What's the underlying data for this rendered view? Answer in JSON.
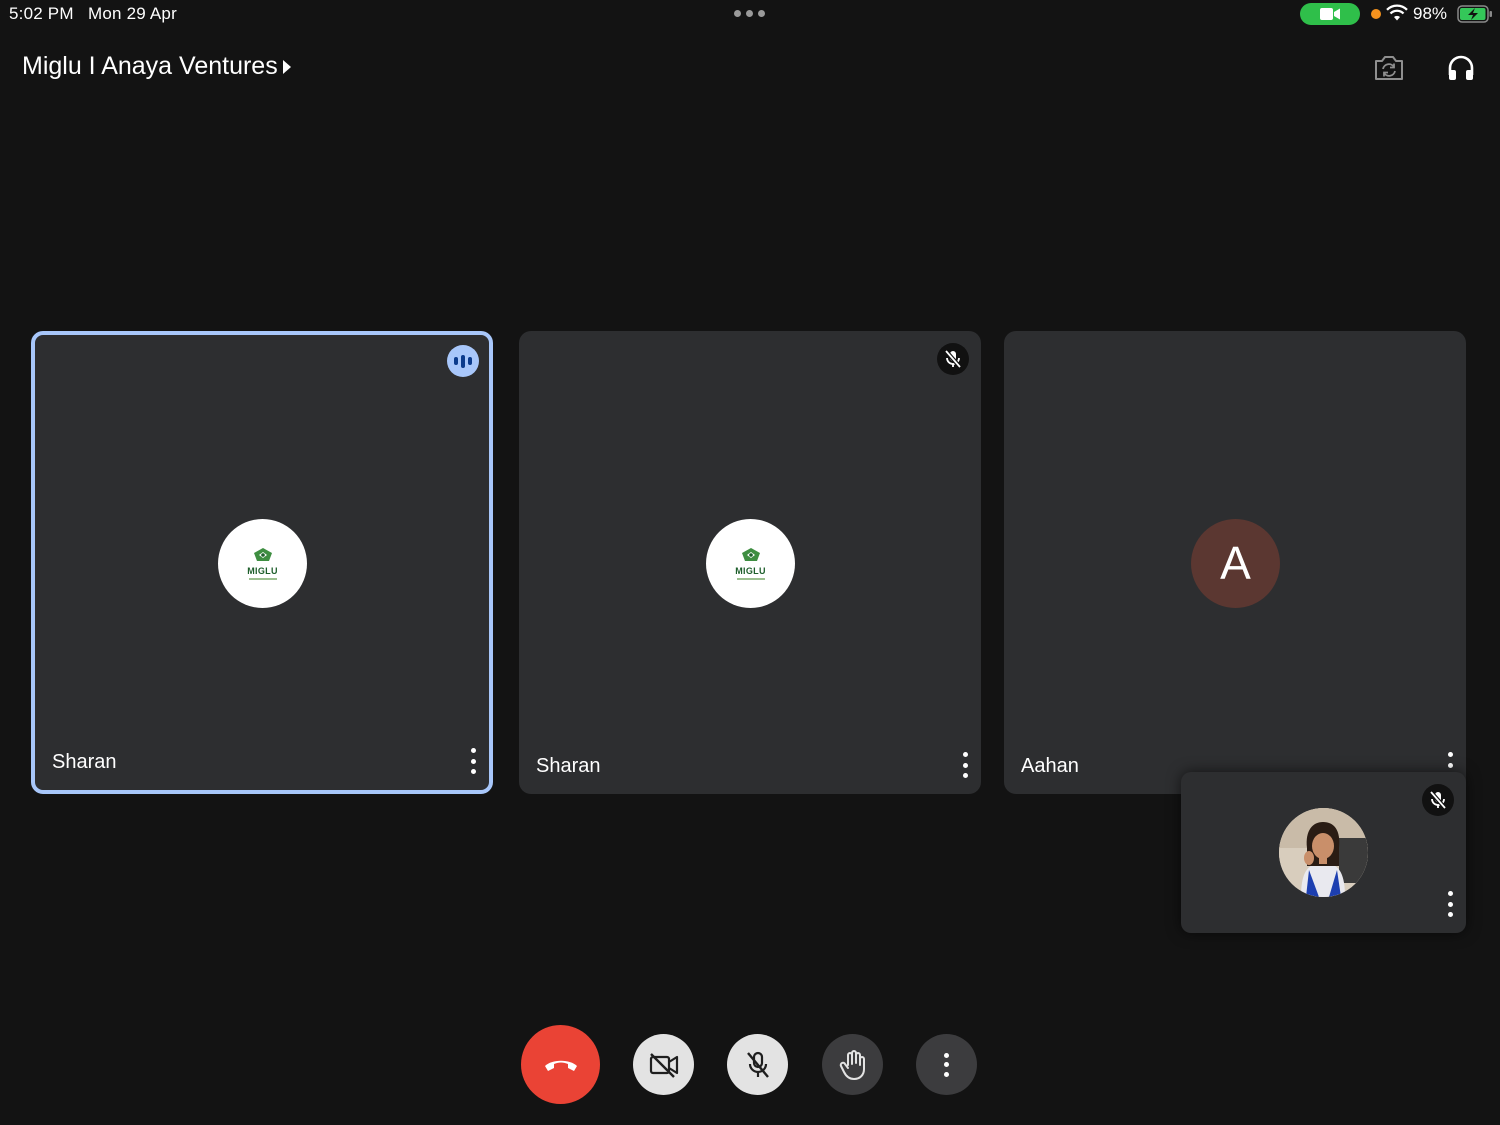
{
  "status_bar": {
    "time": "5:02 PM",
    "date": "Mon 29 Apr",
    "battery": "98%",
    "battery_level": 0.98
  },
  "header": {
    "title": "Miglu I Anaya Ventures",
    "buttons": [
      "switch-camera-icon",
      "audio-output-icon"
    ]
  },
  "participants": [
    {
      "name": "Sharan",
      "avatar": "MIGLU",
      "state": "speaking"
    },
    {
      "name": "Sharan",
      "avatar": "MIGLU",
      "state": "muted"
    },
    {
      "name": "Aahan",
      "avatar": "A",
      "state": "none"
    }
  ],
  "self_view": {
    "state": "muted"
  },
  "controls": [
    "end-call",
    "camera-off",
    "mic-off",
    "raise-hand",
    "more-options"
  ],
  "colors": {
    "background": "#131313",
    "tile": "#2d2e30",
    "active_border": "#a8c7fa",
    "end_call": "#ea4335",
    "control_light": "#e3e3e3",
    "control_dark": "#3c3c3e",
    "aahan_avatar": "#5b3731",
    "video_indicator": "#2fbf4a"
  }
}
